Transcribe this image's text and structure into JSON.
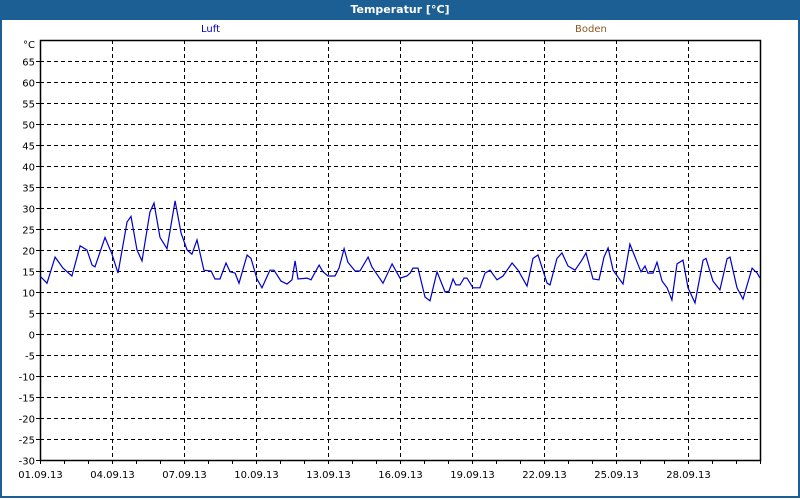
{
  "window": {
    "title": "Temperatur [°C]"
  },
  "chart_data": {
    "type": "line",
    "title": "Temperatur [°C]",
    "ylabel": "°C",
    "xlabel": "",
    "ylim": [
      -30,
      70
    ],
    "yticks": [
      -30,
      -25,
      -20,
      -15,
      -10,
      -5,
      0,
      5,
      10,
      15,
      20,
      25,
      30,
      35,
      40,
      45,
      50,
      55,
      60,
      65
    ],
    "xlim_days": [
      0,
      30
    ],
    "xtick_labels": [
      "01.09.13",
      "04.09.13",
      "07.09.13",
      "10.09.13",
      "13.09.13",
      "16.09.13",
      "19.09.13",
      "22.09.13",
      "25.09.13",
      "28.09.13"
    ],
    "xtick_step_days": 3,
    "grid": true,
    "legend": [
      {
        "name": "Luft",
        "color": "#0000cc"
      },
      {
        "name": "Boden",
        "color": "#8b5a1e"
      }
    ],
    "series": [
      {
        "name": "Luft",
        "color": "#0000cc",
        "x_days": [
          0,
          0.29,
          0.63,
          0.96,
          1.33,
          1.67,
          1.96,
          2.17,
          2.29,
          2.71,
          3,
          3.25,
          3.63,
          3.79,
          4.04,
          4.25,
          4.58,
          4.75,
          5,
          5.29,
          5.63,
          5.88,
          6.13,
          6.33,
          6.54,
          6.83,
          7.13,
          7.29,
          7.5,
          7.75,
          7.92,
          8.13,
          8.29,
          8.63,
          8.79,
          9.04,
          9.25,
          9.58,
          9.75,
          10.04,
          10.29,
          10.5,
          10.63,
          10.75,
          11.13,
          11.29,
          11.63,
          11.79,
          12,
          12.29,
          12.46,
          12.67,
          12.83,
          13.13,
          13.33,
          13.67,
          13.83,
          14.29,
          14.67,
          15,
          15.29,
          15.42,
          15.54,
          15.75,
          16.04,
          16.25,
          16.54,
          16.88,
          17.04,
          17.21,
          17.33,
          17.5,
          17.67,
          17.79,
          18.04,
          18.33,
          18.54,
          18.75,
          19.04,
          19.29,
          19.67,
          19.92,
          20.29,
          20.54,
          20.75,
          21.13,
          21.25,
          21.54,
          21.75,
          22,
          22.29,
          22.58,
          22.75,
          23.04,
          23.29,
          23.5,
          23.67,
          23.88,
          24.29,
          24.58,
          24.88,
          25.04,
          25.21,
          25.33,
          25.54,
          25.71,
          25.92,
          26.13,
          26.33,
          26.54,
          26.79,
          27,
          27.29,
          27.63,
          27.75,
          28.04,
          28.33,
          28.63,
          28.75,
          29.04,
          29.29,
          29.67,
          29.88,
          30
        ],
        "values": [
          13.8,
          12.1,
          18.3,
          15.7,
          13.8,
          21,
          20,
          16.4,
          16,
          23,
          19,
          14.5,
          26.7,
          28,
          20,
          17.4,
          29,
          31.2,
          23,
          20.3,
          31.7,
          24,
          20,
          19,
          22.4,
          15.2,
          15,
          13.1,
          13.1,
          16.9,
          14.8,
          14.5,
          12.1,
          18.8,
          18,
          13.1,
          11,
          15.2,
          15.2,
          12.6,
          11.9,
          12.9,
          17.4,
          13.1,
          13.3,
          12.9,
          16.4,
          14.8,
          13.8,
          13.8,
          15.7,
          20.3,
          17.1,
          15,
          15,
          18.3,
          16,
          12.1,
          16.7,
          13.3,
          13.8,
          14.5,
          15.7,
          15.7,
          8.8,
          7.9,
          14.8,
          10,
          10.2,
          13.1,
          11.7,
          11.7,
          13.3,
          13.3,
          11,
          11,
          14.5,
          15.2,
          12.9,
          13.8,
          16.9,
          15.2,
          11.4,
          18,
          18.8,
          12.1,
          11.7,
          18,
          19.3,
          16.2,
          15.2,
          17.6,
          19.3,
          13.1,
          12.9,
          18.3,
          20.5,
          15.2,
          11.9,
          21.4,
          17.1,
          14.8,
          16.2,
          14.5,
          14.5,
          17.1,
          12.6,
          11,
          8.1,
          16.7,
          17.6,
          11,
          7.4,
          17.6,
          18,
          12.6,
          10.5,
          17.9,
          18.3,
          11,
          8.3,
          15.7,
          14.5,
          13.3
        ]
      }
    ]
  }
}
